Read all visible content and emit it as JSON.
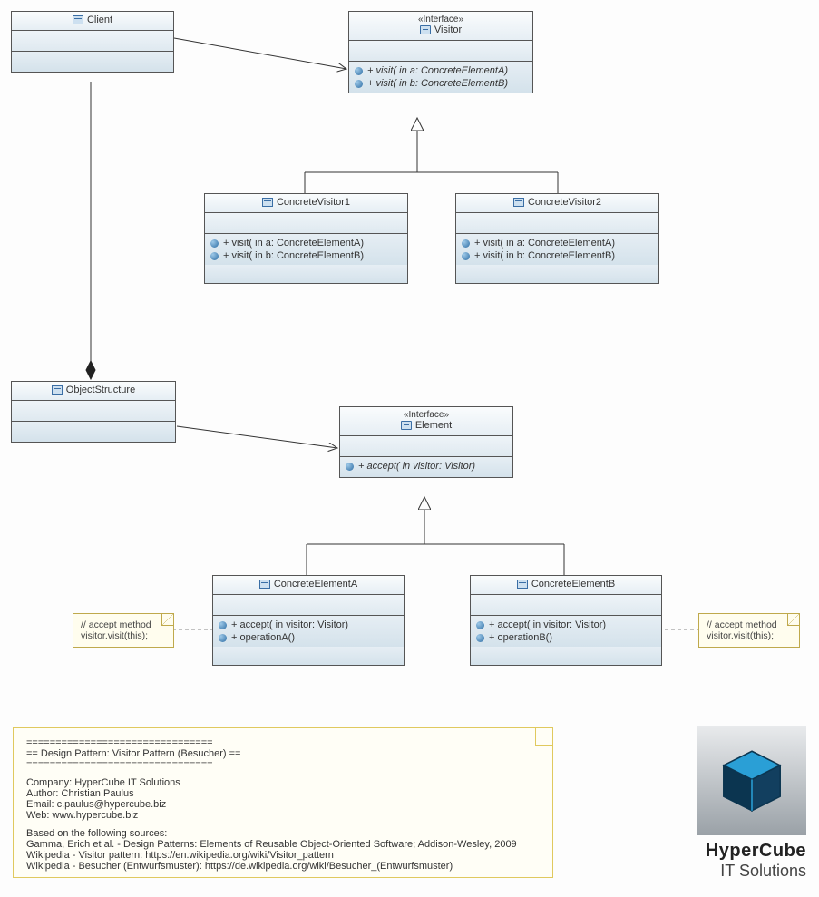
{
  "classes": {
    "client": {
      "name": "Client"
    },
    "visitor": {
      "stereotype": "«Interface»",
      "name": "Visitor",
      "ops": [
        "+ visit(  in a: ConcreteElementA)",
        "+ visit(  in b: ConcreteElementB)"
      ]
    },
    "concreteVisitor1": {
      "name": "ConcreteVisitor1",
      "ops": [
        "+ visit(  in a: ConcreteElementA)",
        "+ visit(  in b: ConcreteElementB)"
      ]
    },
    "concreteVisitor2": {
      "name": "ConcreteVisitor2",
      "ops": [
        "+ visit(  in a: ConcreteElementA)",
        "+ visit(  in b: ConcreteElementB)"
      ]
    },
    "objectStructure": {
      "name": "ObjectStructure"
    },
    "element": {
      "stereotype": "«Interface»",
      "name": "Element",
      "ops": [
        "+ accept(  in visitor: Visitor)"
      ]
    },
    "concreteElementA": {
      "name": "ConcreteElementA",
      "ops": [
        "+ accept(  in visitor: Visitor)",
        "+ operationA()"
      ]
    },
    "concreteElementB": {
      "name": "ConcreteElementB",
      "ops": [
        "+ accept(  in visitor: Visitor)",
        "+ operationB()"
      ]
    }
  },
  "notes": {
    "left": {
      "line1": "// accept method",
      "line2": "visitor.visit(this);"
    },
    "right": {
      "line1": "// accept method",
      "line2": "visitor.visit(this);"
    }
  },
  "info": {
    "sep": "================================",
    "title": "== Design Pattern: Visitor Pattern (Besucher) ==",
    "company": "Company: HyperCube IT Solutions",
    "author": "Author: Christian Paulus",
    "email": "Email: c.paulus@hypercube.biz",
    "web": "Web: www.hypercube.biz",
    "basedOn": "Based on the following sources:",
    "src1": "Gamma, Erich et al. - Design Patterns: Elements of Reusable Object-Oriented Software; Addison-Wesley, 2009",
    "src2": "Wikipedia - Visitor pattern: https://en.wikipedia.org/wiki/Visitor_pattern",
    "src3": "Wikipedia - Besucher (Entwurfsmuster): https://de.wikipedia.org/wiki/Besucher_(Entwurfsmuster)"
  },
  "logo": {
    "line1": "HyperCube",
    "line2": "IT Solutions"
  }
}
